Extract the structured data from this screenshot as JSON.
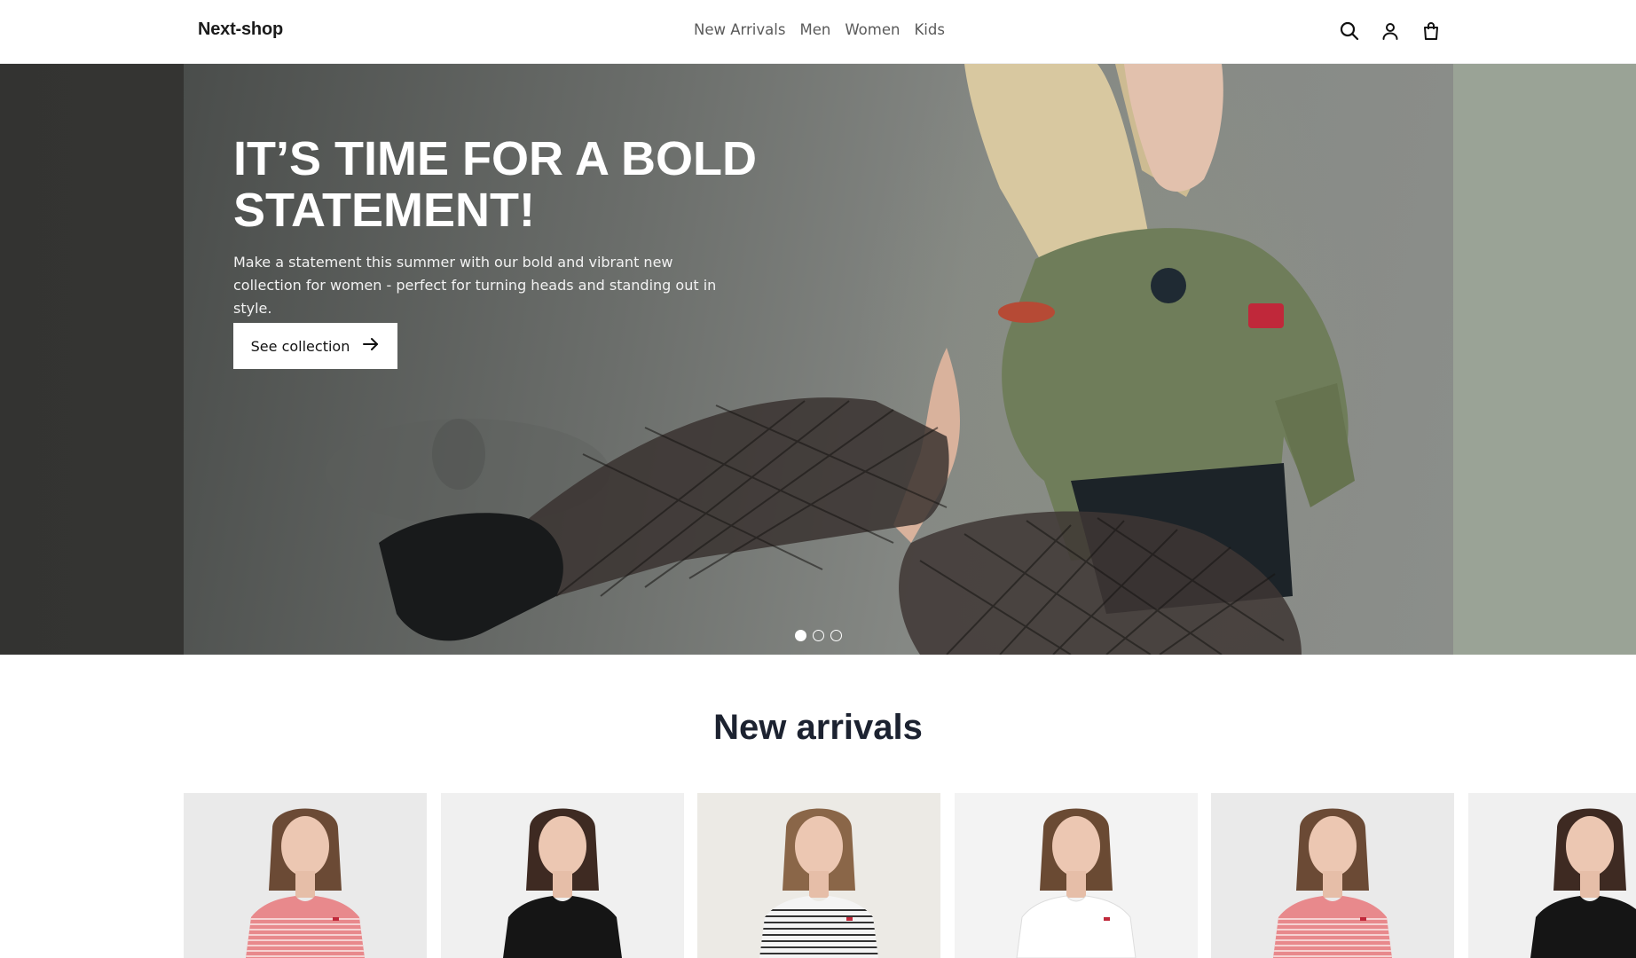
{
  "header": {
    "logo": "Next-shop",
    "nav": [
      "New Arrivals",
      "Men",
      "Women",
      "Kids"
    ],
    "icons": [
      "search-icon",
      "user-icon",
      "shopping-bag-icon"
    ]
  },
  "hero": {
    "title": "IT’S TIME FOR A BOLD STATEMENT!",
    "subtitle": "Make a statement this summer with our bold and vibrant new collection for women - perfect for turning heads and standing out in style.",
    "button_label": "See collection",
    "slides_total": 3,
    "active_slide": 1
  },
  "new_arrivals": {
    "title": "New arrivals",
    "products": [
      {
        "shirt": "red-striped",
        "bg": "#eaeaea"
      },
      {
        "shirt": "black",
        "bg": "#f0f0f0"
      },
      {
        "shirt": "white-striped",
        "bg": "#eceae5"
      },
      {
        "shirt": "white",
        "bg": "#f3f3f3"
      },
      {
        "shirt": "red-striped",
        "bg": "#eaeaea"
      },
      {
        "shirt": "black",
        "bg": "#f0f0f0"
      }
    ]
  },
  "colors": {
    "accent_text": "#1c2230",
    "nav_text": "#5a5a5a"
  }
}
